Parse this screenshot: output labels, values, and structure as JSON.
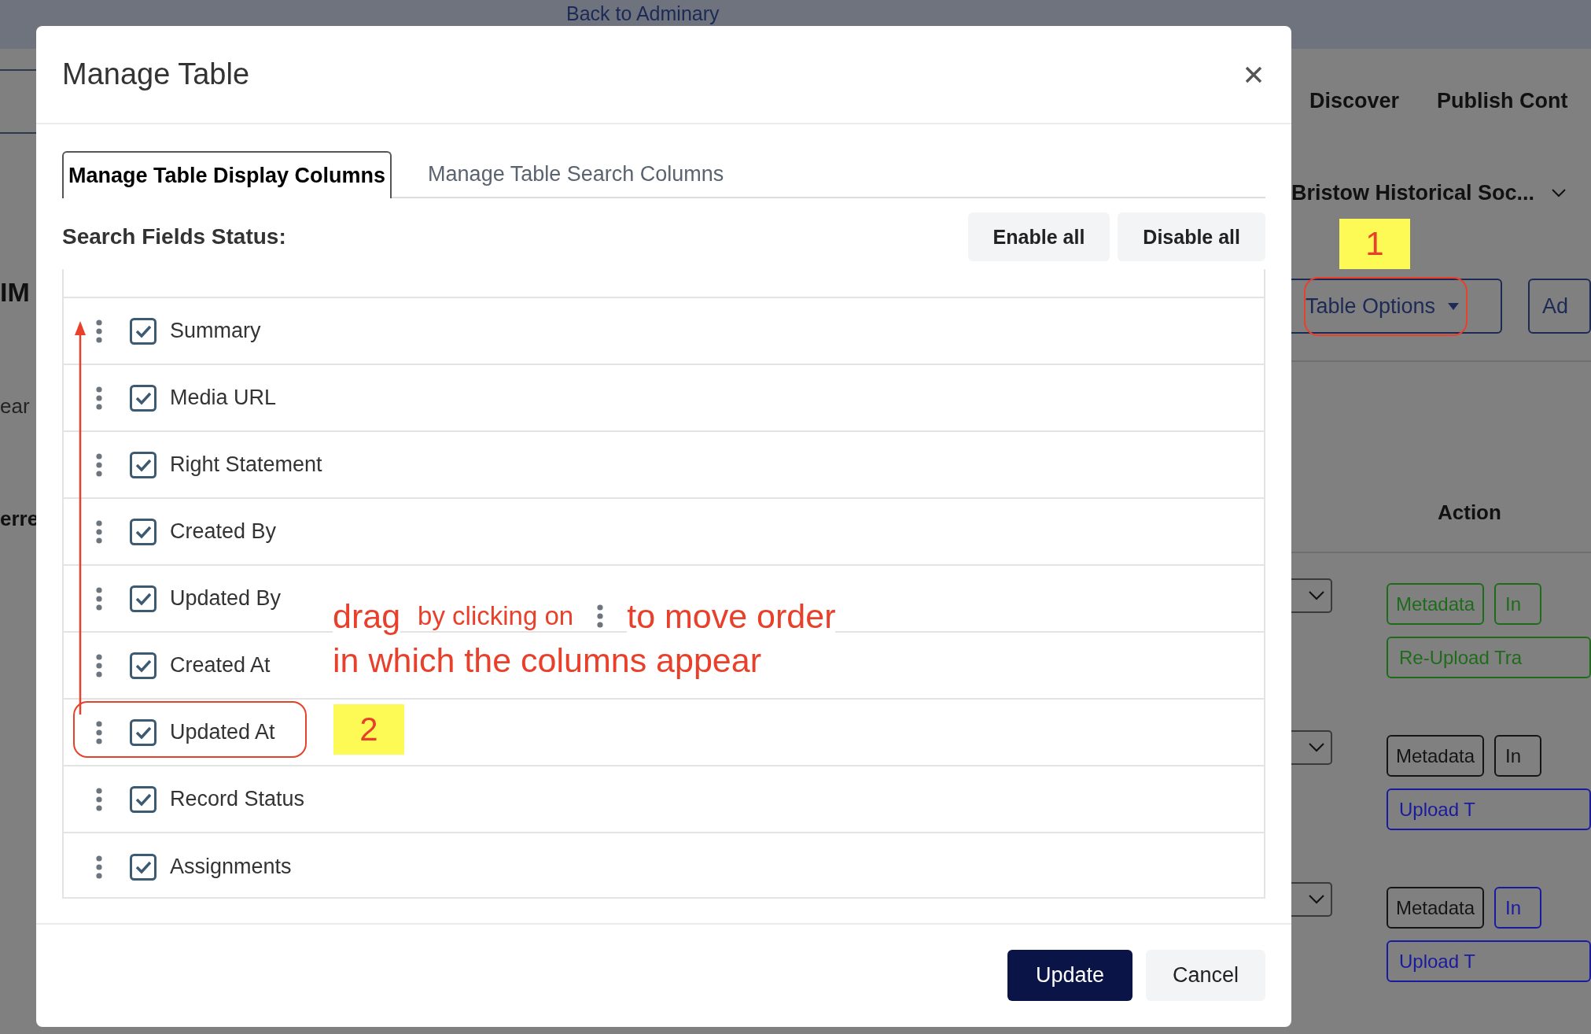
{
  "top_bar": {
    "link": "Back to Adminary"
  },
  "background": {
    "left_texts": [
      {
        "text": "IM",
        "kind": "heading"
      },
      {
        "text": "ear",
        "kind": "label"
      },
      {
        "text": "erre",
        "kind": "header"
      }
    ],
    "nav": [
      "Discover",
      "Publish Cont"
    ],
    "organization": "Bristow Historical Soc...",
    "toolbar": [
      {
        "label": "Table Options",
        "kind": "dropdown"
      },
      {
        "label": "Ad",
        "kind": "button"
      }
    ],
    "column_header": "Action",
    "rows": [
      {
        "buttons": [
          {
            "label": "Metadata",
            "color": "#1e6b1a"
          },
          {
            "label": "In",
            "color": "#1e6b1a"
          },
          {
            "label": "Re-Upload Tra",
            "color": "#1e6b1a"
          }
        ]
      },
      {
        "buttons": [
          {
            "label": "Metadata",
            "color": "#151515"
          },
          {
            "label": "In",
            "color": "#151515"
          },
          {
            "label": "Upload T",
            "color": "#1a1aa0"
          }
        ]
      },
      {
        "buttons": [
          {
            "label": "Metadata",
            "color": "#151515"
          },
          {
            "label": "In",
            "color": "#1a1aa0"
          },
          {
            "label": "Upload T",
            "color": "#1a1aa0"
          }
        ]
      }
    ]
  },
  "modal": {
    "title": "Manage Table",
    "tabs": [
      {
        "label": "Manage Table Display Columns",
        "selected": true
      },
      {
        "label": "Manage Table Search Columns",
        "selected": false
      }
    ],
    "section_title": "Search Fields Status:",
    "actions": [
      "Enable all",
      "Disable all"
    ],
    "fields": [
      {
        "label": "Summary",
        "checked": true
      },
      {
        "label": "Media URL",
        "checked": true
      },
      {
        "label": "Right Statement",
        "checked": true
      },
      {
        "label": "Created By",
        "checked": true
      },
      {
        "label": "Updated By",
        "checked": true
      },
      {
        "label": "Created At",
        "checked": true
      },
      {
        "label": "Updated At",
        "checked": true
      },
      {
        "label": "Record Status",
        "checked": true
      },
      {
        "label": "Assignments",
        "checked": true
      }
    ],
    "footer_buttons": [
      {
        "label": "Update",
        "kind": "primary"
      },
      {
        "label": "Cancel",
        "kind": "secondary"
      }
    ]
  },
  "annotations": {
    "callouts": [
      "1",
      "2"
    ],
    "note": [
      {
        "kind": "large",
        "text": "drag"
      },
      {
        "kind": "small",
        "text": "by clicking on"
      },
      {
        "kind": "handle"
      },
      {
        "kind": "large",
        "text": "to move order"
      },
      {
        "kind": "break"
      },
      {
        "kind": "large",
        "text": "in which the columns appear"
      }
    ]
  }
}
